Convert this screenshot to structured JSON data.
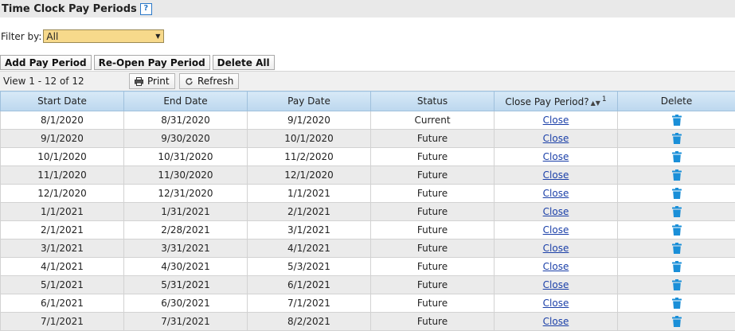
{
  "header": {
    "title": "Time Clock Pay Periods",
    "help_glyph": "?"
  },
  "filter": {
    "label": "Filter by:",
    "selected": "All"
  },
  "actions": {
    "add": "Add Pay Period",
    "reopen": "Re-Open Pay Period",
    "delete_all": "Delete All"
  },
  "toolbar": {
    "view_text": "View 1 - 12 of 12",
    "print": "Print",
    "refresh": "Refresh"
  },
  "columns": [
    "Start Date",
    "End Date",
    "Pay Date",
    "Status",
    "Close Pay Period?",
    "Delete"
  ],
  "close_sort_rank": "1",
  "rows": [
    {
      "start": "8/1/2020",
      "end": "8/31/2020",
      "pay": "9/1/2020",
      "status": "Current",
      "close": "Close"
    },
    {
      "start": "9/1/2020",
      "end": "9/30/2020",
      "pay": "10/1/2020",
      "status": "Future",
      "close": "Close"
    },
    {
      "start": "10/1/2020",
      "end": "10/31/2020",
      "pay": "11/2/2020",
      "status": "Future",
      "close": "Close"
    },
    {
      "start": "11/1/2020",
      "end": "11/30/2020",
      "pay": "12/1/2020",
      "status": "Future",
      "close": "Close"
    },
    {
      "start": "12/1/2020",
      "end": "12/31/2020",
      "pay": "1/1/2021",
      "status": "Future",
      "close": "Close"
    },
    {
      "start": "1/1/2021",
      "end": "1/31/2021",
      "pay": "2/1/2021",
      "status": "Future",
      "close": "Close"
    },
    {
      "start": "2/1/2021",
      "end": "2/28/2021",
      "pay": "3/1/2021",
      "status": "Future",
      "close": "Close"
    },
    {
      "start": "3/1/2021",
      "end": "3/31/2021",
      "pay": "4/1/2021",
      "status": "Future",
      "close": "Close"
    },
    {
      "start": "4/1/2021",
      "end": "4/30/2021",
      "pay": "5/3/2021",
      "status": "Future",
      "close": "Close"
    },
    {
      "start": "5/1/2021",
      "end": "5/31/2021",
      "pay": "6/1/2021",
      "status": "Future",
      "close": "Close"
    },
    {
      "start": "6/1/2021",
      "end": "6/30/2021",
      "pay": "7/1/2021",
      "status": "Future",
      "close": "Close"
    },
    {
      "start": "7/1/2021",
      "end": "7/31/2021",
      "pay": "8/2/2021",
      "status": "Future",
      "close": "Close"
    }
  ],
  "colors": {
    "trash_icon": "#1a8fd8",
    "header_bg": "#c7def2",
    "alt_row": "#ebebeb",
    "filter_bg": "#f7d98b",
    "link": "#1a3fa8"
  }
}
